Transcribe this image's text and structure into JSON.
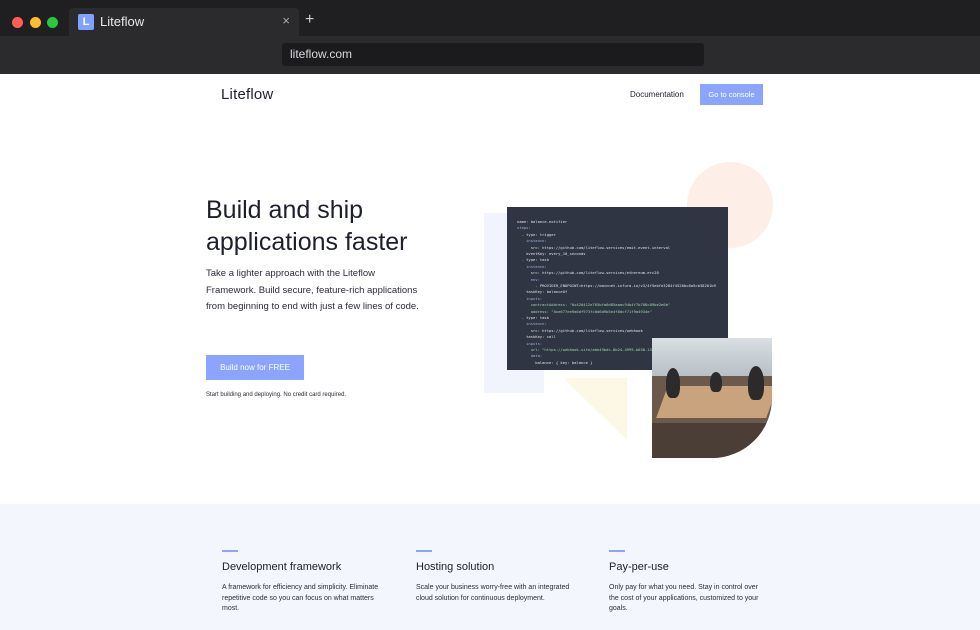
{
  "browser": {
    "tab_title": "Liteflow",
    "favicon_letter": "L",
    "url": "liteflow.com",
    "new_tab_glyph": "+",
    "close_glyph": "×"
  },
  "nav": {
    "logo": "Liteflow",
    "documentation": "Documentation",
    "console_button": "Go to console"
  },
  "hero": {
    "title": "Build and ship applications faster",
    "description": "Take a lighter approach with the Liteflow Framework. Build secure, feature-rich applications from beginning to end with just a few lines of code.",
    "cta_button": "Build now for FREE",
    "cta_note": "Start building and deploying. No credit card required."
  },
  "code_sample": [
    "name: balance-notifier",
    "steps:",
    "  - type: trigger",
    "    instance:",
    "      src: https://github.com/liteflow-services/emit-event-interval",
    "    eventKey: every_10_seconds",
    "  - type: task",
    "    instance:",
    "      src: https://github.com/liteflow-services/ethereum-erc20",
    "      env:",
    "        - PROVIDER_ENDPOINT=https://mainnet.infura.io/v3/4f5ebfe3284f4526bc8a5cb38261b9",
    "    taskKey: balanceOf",
    "    inputs:",
    "      contractAddress: \"0x420412e765bfa6d85aaac94b4f7b708c89be2e0b\"",
    "      address: \"0xe677ee9a6df973fc0d6d9b5e4f8dcf71f9a4934e\"",
    "  - type: task",
    "    instance:",
    "      src: https://github.com/liteflow-services/webhook",
    "    taskKey: call",
    "    inputs:",
    "      url: \"https://webhook.site/abe49bdc-8b24-4999-b658-1528\"",
    "      data:",
    "        balance: { key: balance }"
  ],
  "features": [
    {
      "title": "Development framework",
      "text": "A framework for efficiency and simplicity. Eliminate repetitive code so you can focus on what matters most."
    },
    {
      "title": "Hosting solution",
      "text": "Scale your business worry-free with an integrated cloud solution for continuous deployment."
    },
    {
      "title": "Pay-per-use",
      "text": "Only pay for what you need. Stay in control over the cost of your applications, customized to your goals."
    }
  ],
  "colors": {
    "accent": "#8ba5ff",
    "features_bg": "#f3f6fc",
    "code_bg": "#2f3542"
  }
}
